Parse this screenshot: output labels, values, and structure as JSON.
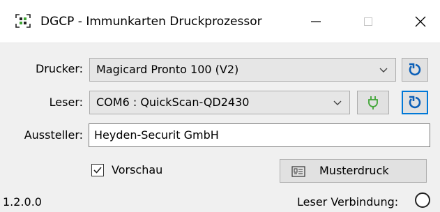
{
  "window": {
    "title": "DGCP - Immunkarten Druckprozessor",
    "icon": "qr-scan-icon",
    "controls": [
      "minimize",
      "maximize",
      "close"
    ]
  },
  "form": {
    "printer": {
      "label": "Drucker:",
      "value": "Magicard Pronto 100 (V2)"
    },
    "reader": {
      "label": "Leser:",
      "value": "COM6 : QuickScan-QD2430"
    },
    "issuer": {
      "label": "Aussteller:",
      "value": "Heyden-Securit GmbH"
    }
  },
  "preview": {
    "label": "Vorschau",
    "checked": true
  },
  "sample_print": {
    "label": "Musterdruck",
    "icon": "id-card-icon"
  },
  "status": {
    "version": "1.2.0.0",
    "reader_connection_label": "Leser Verbindung:",
    "reader_connected": false
  },
  "colors": {
    "accent": "#0078d7",
    "plug_green": "#3fa535",
    "window_bg": "#f0f0f0"
  }
}
